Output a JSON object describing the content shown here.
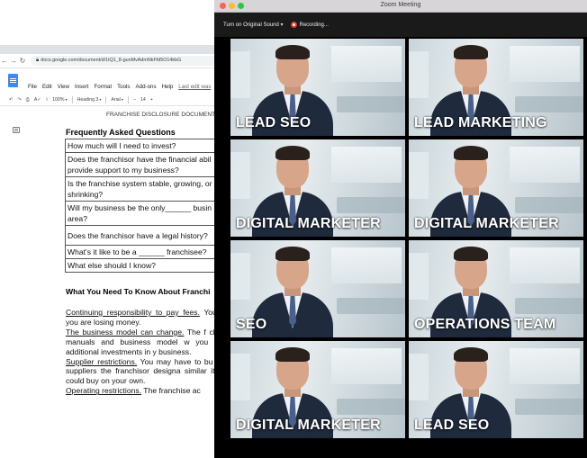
{
  "docs": {
    "url": "docs.google.com/document/d/1tQ1_8-gunMvAdmNkFfd5O14kbG",
    "menu": [
      "File",
      "Edit",
      "View",
      "Insert",
      "Format",
      "Tools",
      "Add-ons",
      "Help"
    ],
    "last_edit": "Last edit was",
    "toolbar": {
      "zoom": "100%",
      "style": "Heading 3",
      "font": "Arial",
      "size": "14"
    },
    "header_text": "FRANCHISE DISCLOSURE DOCUMENT",
    "faq_title": "Frequently Asked Questions",
    "faq_rows": [
      "How much will I need to invest?",
      "Does the franchisor have the financial abil provide support to my business?",
      "Is the franchise system stable, growing, or shrinking?",
      "Will my business be the only______ busin my area?",
      "Does the franchisor have a legal history?",
      "What's it like to be a ______ franchisee?",
      "What else should I know?"
    ],
    "need_title": "What You Need To Know About Franchi",
    "paragraphs": [
      {
        "lead": "Continuing responsibility to pay fees.",
        "rest": " You even if you are losing money."
      },
      {
        "lead": "The business model can change.",
        "rest": " The f change its manuals and business model w you to make additional investments in y business."
      },
      {
        "lead": "Supplier restrictions.",
        "rest": " You may have to bu group of suppliers the franchisor designa similar items you could buy on your own."
      },
      {
        "lead": "Operating restrictions.",
        "rest": " The franchise ac"
      }
    ]
  },
  "zoom": {
    "window_title": "Zoom Meeting",
    "original_sound": "Turn on Original Sound",
    "recording": "Recording...",
    "participants": [
      {
        "name": "LEAD SEO"
      },
      {
        "name": "LEAD MARKETING"
      },
      {
        "name": "DIGITAL MARKETER"
      },
      {
        "name": "DIGITAL MARKETER"
      },
      {
        "name": "SEO"
      },
      {
        "name": "OPERATIONS TEAM"
      },
      {
        "name": "DIGITAL MARKETER"
      },
      {
        "name": "LEAD SEO"
      }
    ]
  }
}
